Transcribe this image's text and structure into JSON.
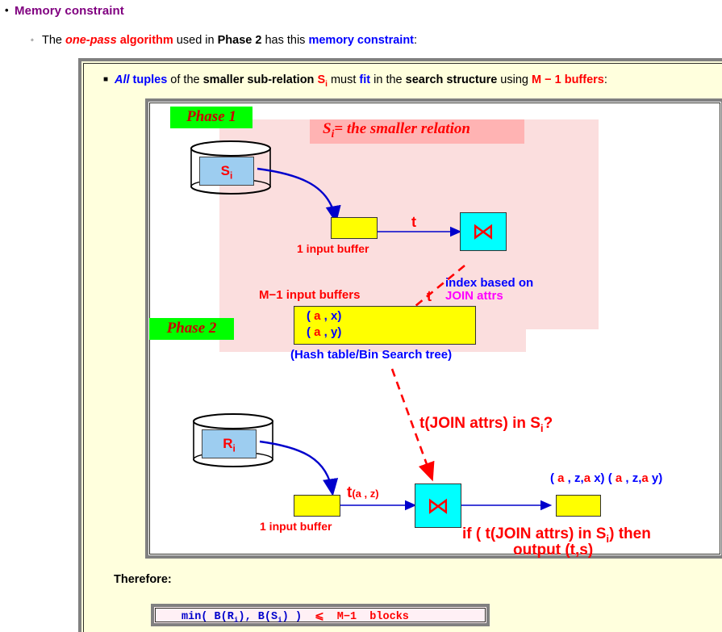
{
  "bullets": {
    "level1": "Memory constraint",
    "level2": {
      "seg1": "The ",
      "seg2": "one-pass",
      "seg3": " algorithm",
      "seg4": " used in ",
      "seg5": "Phase 2",
      "seg6": " has this ",
      "seg7": "memory constraint",
      "seg8": ":"
    },
    "level3": {
      "seg1": "All",
      "seg2": " tuples",
      "seg3": " of the ",
      "seg4": "smaller sub-relation",
      "seg5": "S",
      "seg5sub": "i",
      "seg6": " must ",
      "seg7": "fit",
      "seg8": " in the ",
      "seg9": "search structure",
      "seg10": " using ",
      "seg11": "M − 1 buffers",
      "seg12": ":"
    }
  },
  "diagram": {
    "phase1_label": "Phase 1",
    "phase2_label": "Phase 2",
    "relation_caption_main": "= the smaller relation",
    "relation_caption_sym": "S",
    "relation_caption_sub": "i",
    "cylinder_s_label": "S",
    "cylinder_s_sub": "i",
    "cylinder_r_label": "R",
    "cylinder_r_sub": "i",
    "input_buffer_1": "1 input buffer",
    "input_buffer_2": "1 input buffer",
    "m1_input_buffers": "M−1 input buffers",
    "t_label_top": "t",
    "t_label_mid": "t",
    "index_based_on": "index based on",
    "join_attrs": "JOIN attrs",
    "hash_table_caption": "(Hash table/Bin Search tree)",
    "tuple_x": "( a , x)",
    "tuple_y": "( a , y)",
    "tuple_a": "a",
    "tuple_open": "( ",
    "tuple_x_rest": " , x)",
    "tuple_y_rest": " , y)",
    "t_az_main": "t",
    "t_az_sub": "(a , z)",
    "question": "t(JOIN attrs) in S",
    "question_sub": "i",
    "question_end": "?",
    "output_tuples_1_open": "( ",
    "output_tuples_1_mid": " , z,",
    "output_tuples_1_a2": "a",
    "output_tuples_1_end": " x)",
    "output_tuples_2_open": "( ",
    "output_tuples_2_mid": " , z,",
    "output_tuples_2_a2": "a",
    "output_tuples_2_end": " y)",
    "if_line_1a": "if ( t(JOIN attrs) in S",
    "if_line_1sub": "i",
    "if_line_1b": ") then",
    "if_line_2": "output (t,s)",
    "join_symbol": "⋈"
  },
  "footer": {
    "therefore": "Therefore:",
    "formula_part1": "min( B(R",
    "formula_sub1": "i",
    "formula_part2": "), B(S",
    "formula_sub2": "i",
    "formula_part3": ") )",
    "formula_op": "⩽",
    "formula_part4": "M−1  blocks"
  },
  "colors": {
    "purple": "#800080",
    "red": "#ff0000",
    "blue": "#0000ff",
    "magenta": "#ff00ff",
    "green": "#00ff00",
    "cyan": "#00ffff",
    "yellow": "#ffff00",
    "panel_bg": "#ffffdd",
    "pink_bg": "#fbdede",
    "pink_strip": "#ffb3b3"
  }
}
